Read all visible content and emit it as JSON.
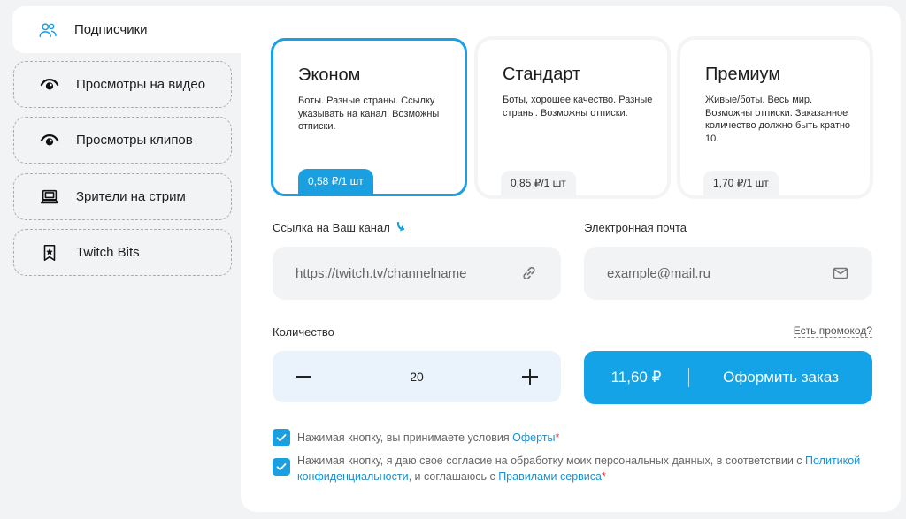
{
  "sidebar": {
    "items": [
      {
        "label": "Подписчики",
        "icon": "users-icon"
      },
      {
        "label": "Просмотры на видео",
        "icon": "eye-icon"
      },
      {
        "label": "Просмотры клипов",
        "icon": "eye-icon"
      },
      {
        "label": "Зрители на стрим",
        "icon": "laptop-icon"
      },
      {
        "label": "Twitch Bits",
        "icon": "bookmark-star-icon"
      }
    ]
  },
  "tariffs": [
    {
      "title": "Эконом",
      "desc": "Боты. Разные страны. Ссылку указывать на канал. Возможны отписки.",
      "price": "0,58 ₽/1 шт",
      "selected": true
    },
    {
      "title": "Стандарт",
      "desc": "Боты, хорошее качество. Разные страны. Возможны отписки.",
      "price": "0,85 ₽/1 шт",
      "selected": false
    },
    {
      "title": "Премиум",
      "desc": "Живые/боты. Весь мир. Возможны отписки. Заказанное количество должно быть кратно 10.",
      "price": "1,70 ₽/1 шт",
      "selected": false
    }
  ],
  "form": {
    "channel_label": "Ссылка на Ваш канал",
    "channel_placeholder": "https://twitch.tv/channelname",
    "email_label": "Электронная почта",
    "email_placeholder": "example@mail.ru",
    "quantity_label": "Количество",
    "quantity_value": "20",
    "promo_label": "Есть промокод?",
    "total": "11,60 ₽",
    "order_label": "Оформить заказ"
  },
  "consents": [
    {
      "text": "Нажимая кнопку, вы принимаете условия ",
      "link": "Оферты",
      "req": "*"
    },
    {
      "text": "Нажимая кнопку, я даю свое согласие на обработку моих персональных данных, в соответствии с ",
      "link1": "Политикой конфиденциальности",
      "mid": ", и соглашаюсь с ",
      "link2": "Правилами сервиса",
      "req": "*"
    }
  ],
  "colors": {
    "accent": "#1a9fe0",
    "button": "#14a3e6",
    "required": "#e0392f"
  }
}
